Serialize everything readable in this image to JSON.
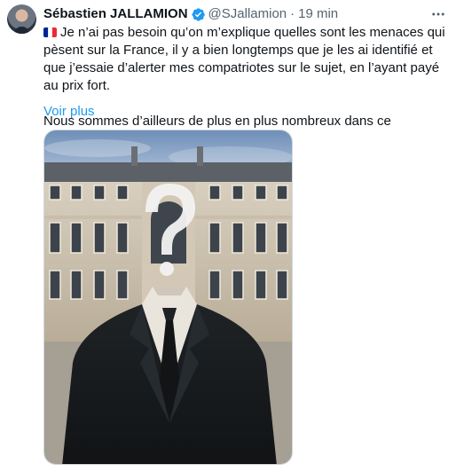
{
  "tweet": {
    "author": {
      "display_name": "Sébastien JALLAMION",
      "handle": "@SJallamion",
      "verified": true
    },
    "separator": "·",
    "time": "19 min",
    "flag_emoji": "french-flag",
    "text": {
      "paragraph_1": "Je n’ai pas besoin qu’on m’explique quelles sont les menaces qui pèsent sur la France, il y a bien longtemps que je les ai identifié et que j’essaie d’alerter mes compatriotes sur le sujet, en l’ayant payé au prix fort.",
      "paragraph_2": "Nous sommes d’ailleurs de plus en plus nombreux dans ce"
    },
    "see_more": "Voir plus",
    "media": {
      "kind": "image",
      "subject": "faceless-man-in-suit-with-question-mark-in-front-of-palace"
    }
  },
  "colors": {
    "link": "#1d9bf0",
    "verified": "#1d9bf0",
    "secondary_text": "#536471",
    "flag_blue": "#002395",
    "flag_white": "#ffffff",
    "flag_red": "#ed2939"
  }
}
